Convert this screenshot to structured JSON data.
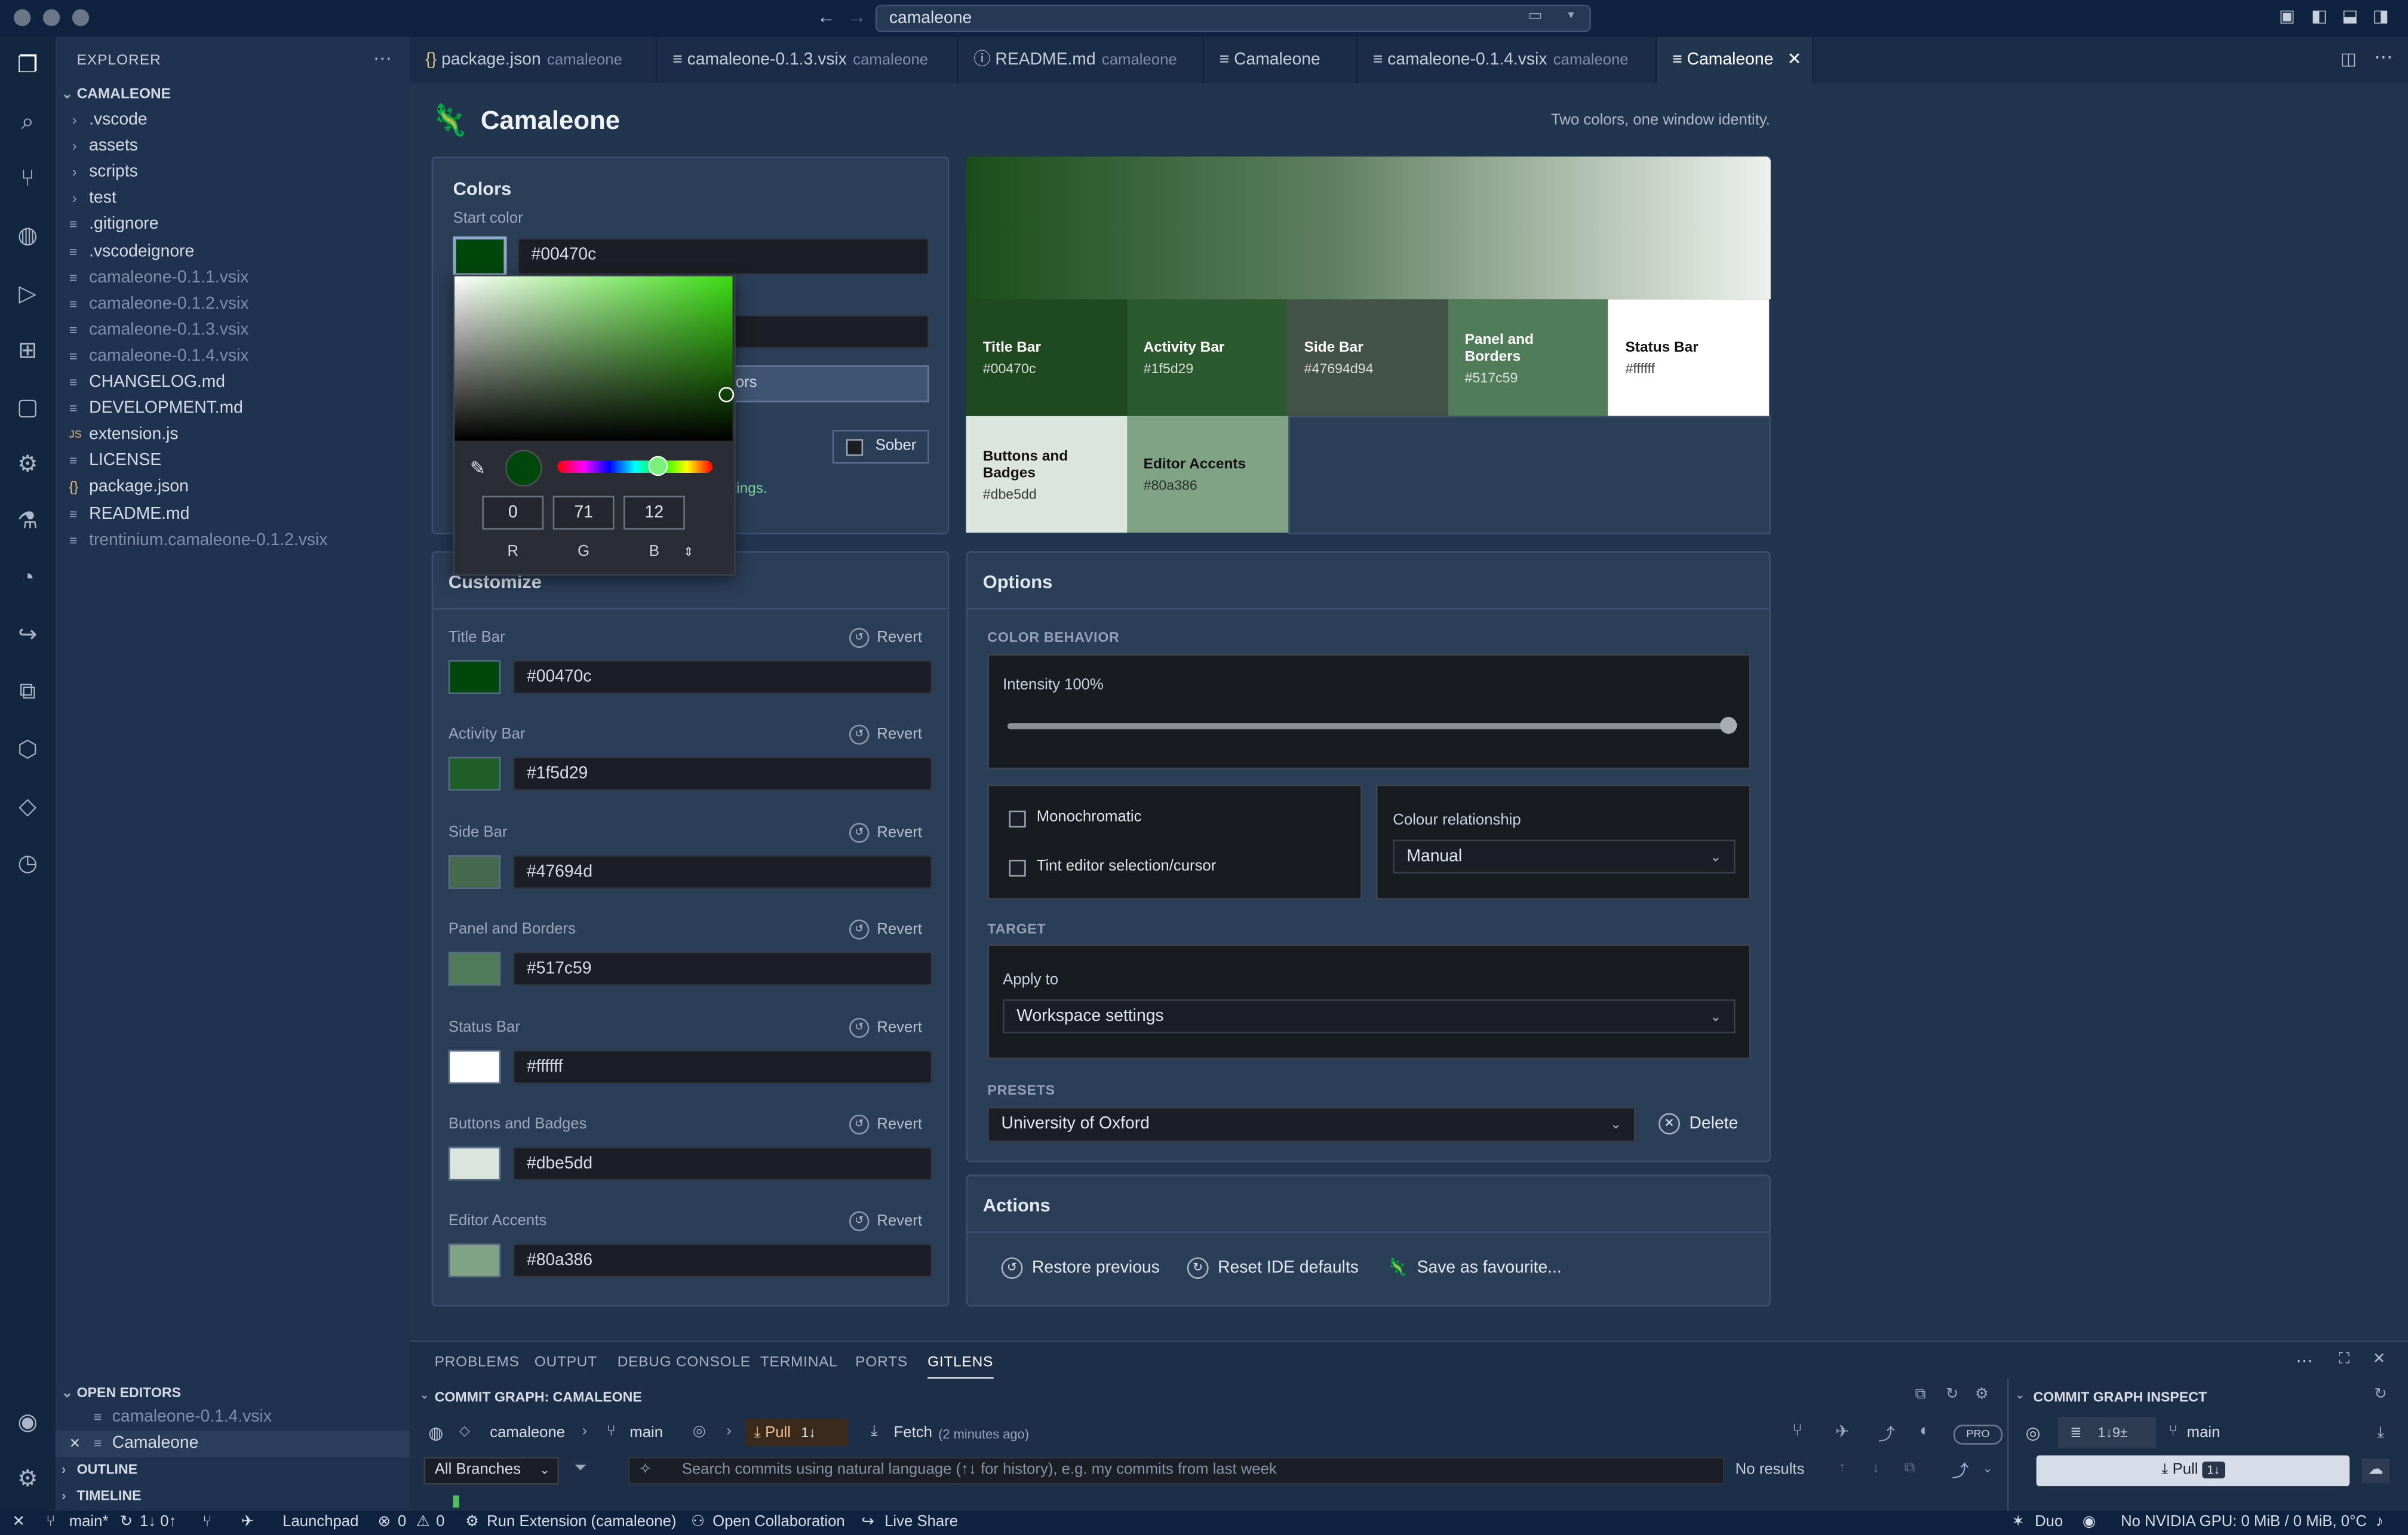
{
  "titlebar": {
    "command_center": "camaleone"
  },
  "explorer": {
    "header": "EXPLORER",
    "root": "CAMALEONE",
    "items": [
      {
        "label": ".vscode",
        "type": "folder"
      },
      {
        "label": "assets",
        "type": "folder"
      },
      {
        "label": "scripts",
        "type": "folder"
      },
      {
        "label": "test",
        "type": "folder"
      },
      {
        "label": ".gitignore",
        "type": "file"
      },
      {
        "label": ".vscodeignore",
        "type": "file"
      },
      {
        "label": "camaleone-0.1.1.vsix",
        "type": "file",
        "dim": true
      },
      {
        "label": "camaleone-0.1.2.vsix",
        "type": "file",
        "dim": true
      },
      {
        "label": "camaleone-0.1.3.vsix",
        "type": "file",
        "dim": true
      },
      {
        "label": "camaleone-0.1.4.vsix",
        "type": "file",
        "dim": true
      },
      {
        "label": "CHANGELOG.md",
        "type": "file"
      },
      {
        "label": "DEVELOPMENT.md",
        "type": "file"
      },
      {
        "label": "extension.js",
        "type": "js"
      },
      {
        "label": "LICENSE",
        "type": "file"
      },
      {
        "label": "package.json",
        "type": "json"
      },
      {
        "label": "README.md",
        "type": "file"
      },
      {
        "label": "trentinium.camaleone-0.1.2.vsix",
        "type": "file",
        "dim": true
      }
    ],
    "open_editors": "OPEN EDITORS",
    "open_items": [
      "camaleone-0.1.4.vsix",
      "Camaleone"
    ],
    "outline": "OUTLINE",
    "timeline": "TIMELINE"
  },
  "tabs": [
    {
      "label": "package.json",
      "sub": "camaleone"
    },
    {
      "label": "camaleone-0.1.3.vsix",
      "sub": "camaleone"
    },
    {
      "label": "README.md",
      "sub": "camaleone"
    },
    {
      "label": "Camaleone",
      "sub": ""
    },
    {
      "label": "camaleone-0.1.4.vsix",
      "sub": "camaleone"
    },
    {
      "label": "Camaleone",
      "sub": ""
    }
  ],
  "page": {
    "title": "Camaleone",
    "tagline": "Two colors, one window identity."
  },
  "colors": {
    "title": "Colors",
    "start_label": "Start color",
    "start_value": "#00470c",
    "start_color": "#00470c",
    "end_value_partial": "",
    "generate_partial": "ors",
    "sober": "Sober",
    "settings_partial": "ettings."
  },
  "picker": {
    "r": "0",
    "g": "71",
    "b": "12",
    "r_label": "R",
    "g_label": "G",
    "b_label": "B"
  },
  "preview": [
    {
      "name": "Title Bar",
      "hex": "#00470c",
      "bg": "#1f4a1f",
      "fg": "#ffffff"
    },
    {
      "name": "Activity Bar",
      "hex": "#1f5d29",
      "bg": "#2a5a2e",
      "fg": "#ffffff"
    },
    {
      "name": "Side Bar",
      "hex": "#47694d94",
      "bg": "#43534a",
      "fg": "#ffffff"
    },
    {
      "name": "Panel and Borders",
      "hex": "#517c59",
      "bg": "#517c59",
      "fg": "#ffffff"
    },
    {
      "name": "Status Bar",
      "hex": "#ffffff",
      "bg": "#ffffff",
      "fg": "#111111"
    },
    {
      "name": "Buttons and Badges",
      "hex": "#dbe5dd",
      "bg": "#dbe5dd",
      "fg": "#111111"
    },
    {
      "name": "Editor Accents",
      "hex": "#80a386",
      "bg": "#80a386",
      "fg": "#111111"
    }
  ],
  "customize": {
    "title": "Customize",
    "revert": "Revert",
    "rows": [
      {
        "label": "Title Bar",
        "value": "#00470c",
        "color": "#00470c"
      },
      {
        "label": "Activity Bar",
        "value": "#1f5d29",
        "color": "#1f5d29"
      },
      {
        "label": "Side Bar",
        "value": "#47694d",
        "color": "#47694d"
      },
      {
        "label": "Panel and Borders",
        "value": "#517c59",
        "color": "#517c59"
      },
      {
        "label": "Status Bar",
        "value": "#ffffff",
        "color": "#ffffff"
      },
      {
        "label": "Buttons and Badges",
        "value": "#dbe5dd",
        "color": "#dbe5dd"
      },
      {
        "label": "Editor Accents",
        "value": "#80a386",
        "color": "#80a386"
      }
    ]
  },
  "options": {
    "title": "Options",
    "color_behavior": "COLOR BEHAVIOR",
    "intensity": "Intensity 100%",
    "intensity_value": 1.0,
    "monochromatic": "Monochromatic",
    "tint": "Tint editor selection/cursor",
    "relationship_label": "Colour relationship",
    "relationship_value": "Manual",
    "target": "TARGET",
    "apply_to_label": "Apply to",
    "apply_to_value": "Workspace settings",
    "presets": "PRESETS",
    "preset_value": "University of Oxford",
    "delete": "Delete"
  },
  "actions": {
    "title": "Actions",
    "restore": "Restore previous",
    "reset": "Reset IDE defaults",
    "save": "Save as favourite..."
  },
  "bottom": {
    "tabs": [
      "PROBLEMS",
      "OUTPUT",
      "DEBUG CONSOLE",
      "TERMINAL",
      "PORTS",
      "GITLENS"
    ],
    "graph_title": "COMMIT GRAPH: CAMALEONE",
    "repo": "camaleone",
    "branch": "main",
    "pull": "Pull",
    "pull_count": "1↓",
    "fetch": "Fetch",
    "fetch_time": "(2 minutes ago)",
    "pro": "PRO",
    "branches": "All Branches",
    "search_placeholder": "Search commits using natural language (↑↓ for history), e.g. my commits from last week",
    "no_results": "No results",
    "inspect_title": "COMMIT GRAPH INSPECT",
    "inspect_badge": "1↓9±",
    "inspect_branch": "main",
    "inspect_pull": "Pull",
    "inspect_pull_badge": "1↓"
  },
  "status": {
    "branch": "main*",
    "sync": "1↓ 0↑",
    "launchpad": "Launchpad",
    "errors": "0",
    "warnings": "0",
    "run": "Run Extension (camaleone)",
    "collab": "Open Collaboration",
    "liveshare": "Live Share",
    "duo": "Duo",
    "gpu": "No NVIDIA GPU: 0 MiB / 0 MiB, 0°C"
  }
}
